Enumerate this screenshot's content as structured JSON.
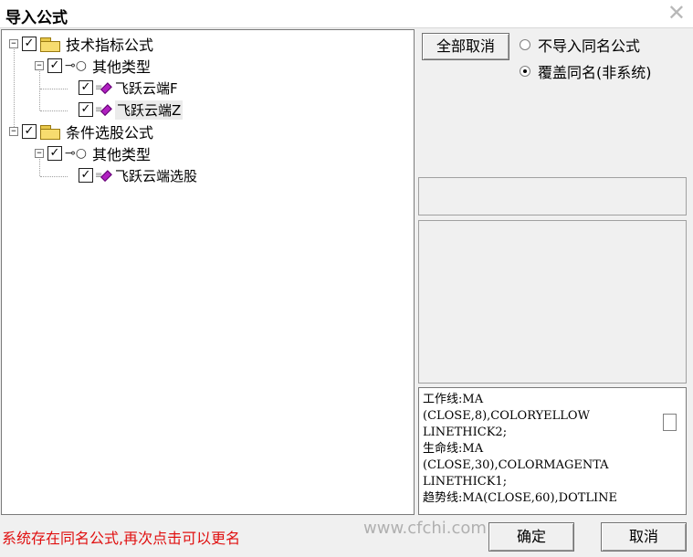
{
  "window": {
    "title": "导入公式",
    "close_icon": "close-icon"
  },
  "tree": {
    "nodes": [
      {
        "label": "技术指标公式",
        "checked": true,
        "icon": "folder-icon"
      },
      {
        "label": "其他类型",
        "checked": true,
        "icon": "key-icon"
      },
      {
        "label": "飞跃云端F",
        "checked": true,
        "icon": "formula-icon"
      },
      {
        "label": "飞跃云端Z",
        "checked": true,
        "icon": "formula-icon"
      },
      {
        "label": "条件选股公式",
        "checked": true,
        "icon": "folder-icon"
      },
      {
        "label": "其他类型",
        "checked": true,
        "icon": "key-icon"
      },
      {
        "label": "飞跃云端选股",
        "checked": true,
        "icon": "formula-icon"
      }
    ]
  },
  "right": {
    "cancel_all_label": "全部取消",
    "radio_skip_label": "不导入同名公式",
    "radio_overwrite_label": "覆盖同名(非系统)",
    "selected_option": "覆盖同名(非系统)"
  },
  "code": {
    "lines": [
      "工作线:MA",
      "(CLOSE,8),COLORYELLOW",
      "LINETHICK2;",
      "生命线:MA",
      "(CLOSE,30),COLORMAGENTA",
      "LINETHICK1;",
      "趋势线:MA(CLOSE,60),DOTLINE"
    ]
  },
  "footer": {
    "status": "系统存在同名公式,再次点击可以更名",
    "watermark": "www.cfchi.com",
    "ok_label": "确定",
    "cancel_label": "取消"
  }
}
